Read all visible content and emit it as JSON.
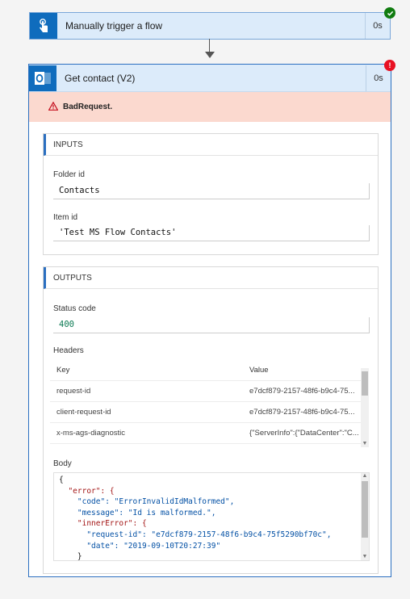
{
  "trigger": {
    "title": "Manually trigger a flow",
    "duration": "0s",
    "status_icon": "check-success",
    "colors": {
      "accent": "#0f6cbd",
      "success": "#107c10"
    }
  },
  "action": {
    "title": "Get contact (V2)",
    "duration": "0s",
    "status_icon": "exclamation-error",
    "error_message": "BadRequest.",
    "colors": {
      "border": "#2b6fc0",
      "error_bg": "#fbd9cf",
      "error": "#e81123"
    }
  },
  "inputs": {
    "heading": "INPUTS",
    "folder_id_label": "Folder id",
    "folder_id_value": "Contacts",
    "item_id_label": "Item id",
    "item_id_value": "'Test MS Flow Contacts'"
  },
  "outputs": {
    "heading": "OUTPUTS",
    "status_code_label": "Status code",
    "status_code_value": "400",
    "headers_label": "Headers",
    "headers_table": {
      "columns": [
        "Key",
        "Value"
      ],
      "rows": [
        {
          "key": "request-id",
          "value": "e7dcf879-2157-48f6-b9c4-75..."
        },
        {
          "key": "client-request-id",
          "value": "e7dcf879-2157-48f6-b9c4-75..."
        },
        {
          "key": "x-ms-ags-diagnostic",
          "value": "{\"ServerInfo\":{\"DataCenter\":\"C..."
        }
      ]
    },
    "body_label": "Body",
    "body_lines": [
      "{",
      "  \"error\": {",
      "    \"code\": \"ErrorInvalidIdMalformed\",",
      "    \"message\": \"Id is malformed.\",",
      "    \"innerError\": {",
      "      \"request-id\": \"e7dcf879-2157-48f6-b9c4-75f5290bf70c\",",
      "      \"date\": \"2019-09-10T20:27:39\"",
      "    }"
    ]
  }
}
